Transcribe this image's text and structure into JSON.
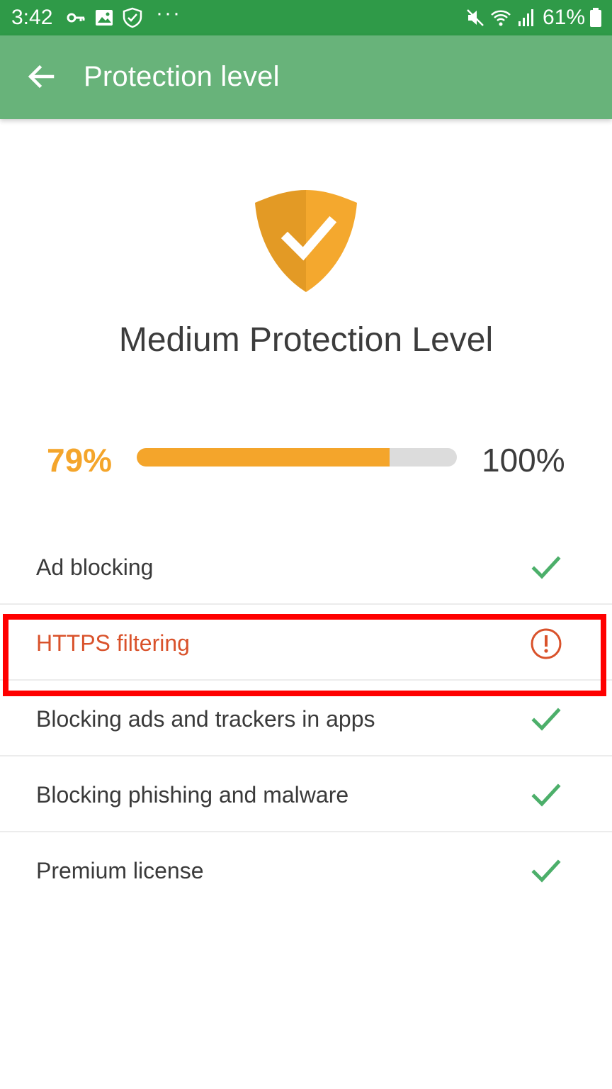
{
  "status_bar": {
    "time": "3:42",
    "battery": "61%",
    "icons": [
      "key-icon",
      "image-icon",
      "shield-check-icon",
      "more-dots-icon",
      "mute-icon",
      "wifi-icon",
      "signal-icon",
      "battery-icon"
    ]
  },
  "app_bar": {
    "title": "Protection level",
    "back_icon": "arrow-back-icon",
    "color": "#68b37a"
  },
  "level": {
    "title": "Medium Protection Level",
    "shield_icon": "shield-check-icon",
    "shield_color": "#f4a52b"
  },
  "progress": {
    "current_label": "79%",
    "max_label": "100%",
    "value": 79,
    "max": 100,
    "fill_color": "#f4a52b"
  },
  "features": [
    {
      "label": "Ad blocking",
      "status": "ok",
      "icon": "check-icon"
    },
    {
      "label": "HTTPS filtering",
      "status": "warning",
      "icon": "warning-circle-icon"
    },
    {
      "label": "Blocking ads and trackers in apps",
      "status": "ok",
      "icon": "check-icon"
    },
    {
      "label": "Blocking phishing and malware",
      "status": "ok",
      "icon": "check-icon"
    },
    {
      "label": "Premium license",
      "status": "ok",
      "icon": "check-icon"
    }
  ],
  "colors": {
    "status_bar": "#2f9a48",
    "ok": "#4caf6a",
    "warning": "#d9522b",
    "highlight": "#ff0000"
  }
}
